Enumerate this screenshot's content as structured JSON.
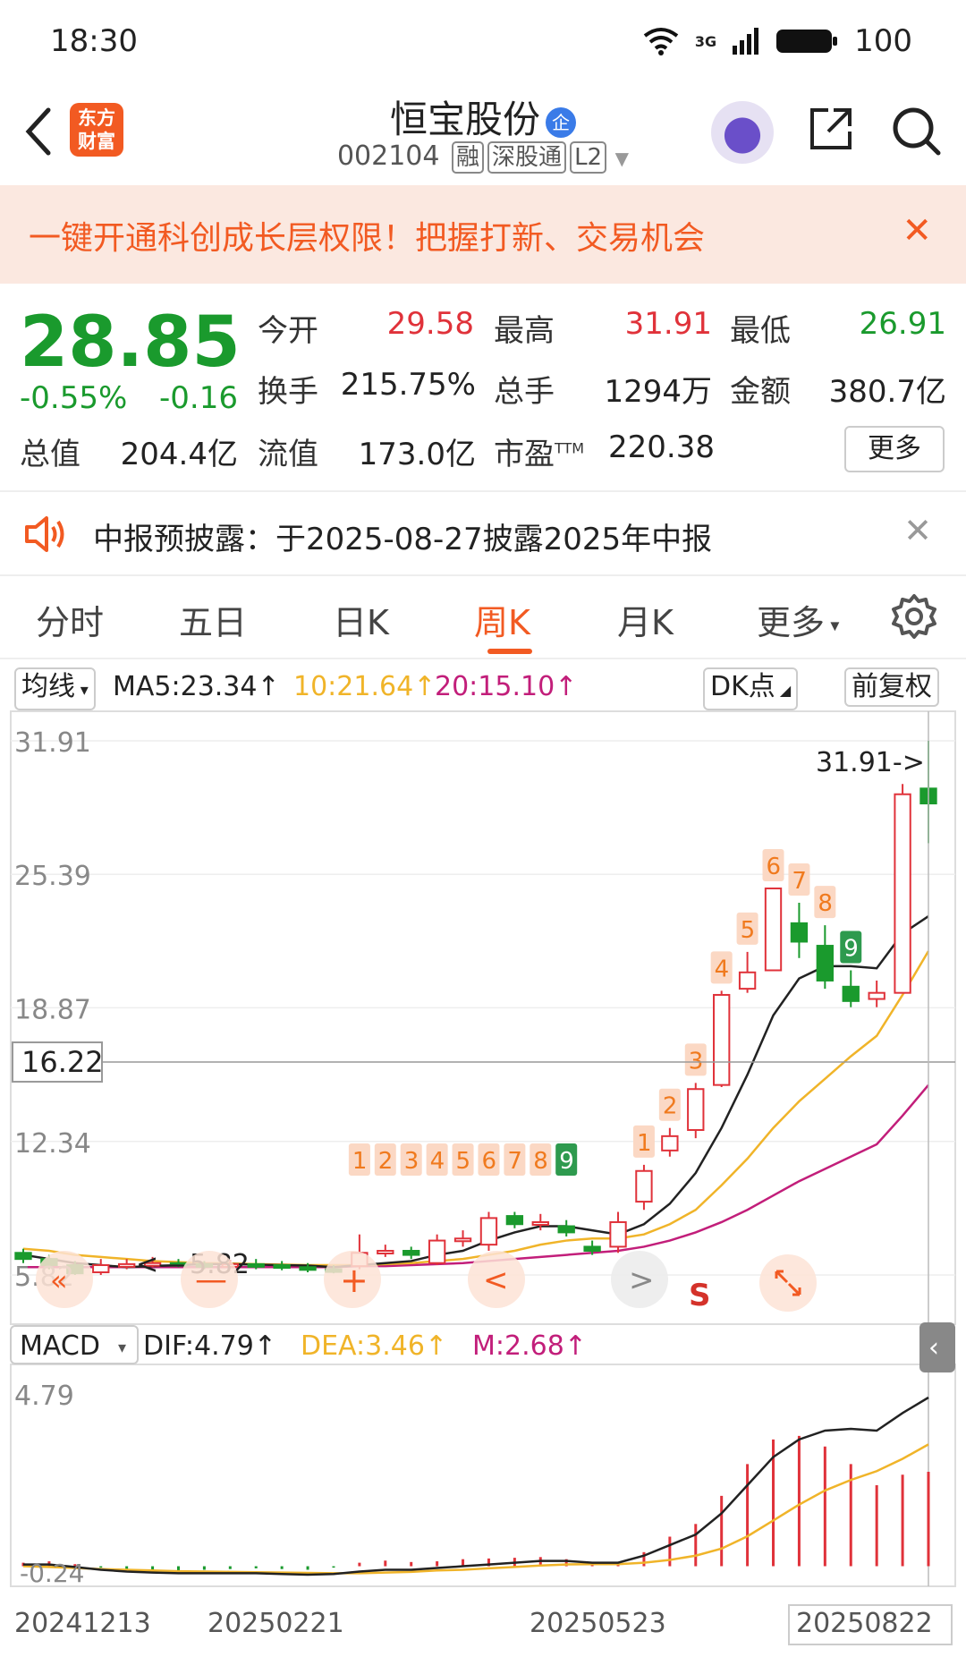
{
  "status": {
    "time": "18:30",
    "battery": "100",
    "network": "3G"
  },
  "header": {
    "title": "恒宝股份",
    "badge": "企",
    "code": "002104",
    "tags": [
      "融",
      "深股通",
      "L2"
    ]
  },
  "banner": {
    "text": "一键开通科创成长层权限！把握打新、交易机会"
  },
  "quote": {
    "price": "28.85",
    "change_pct": "-0.55%",
    "change": "-0.16",
    "fields": [
      {
        "label": "今开",
        "value": "29.58",
        "color": "#e0323a"
      },
      {
        "label": "最高",
        "value": "31.91",
        "color": "#e0323a"
      },
      {
        "label": "最低",
        "value": "26.91",
        "color": "#1a9a2d"
      },
      {
        "label": "换手",
        "value": "215.75%",
        "color": "#222"
      },
      {
        "label": "总手",
        "value": "1294万",
        "color": "#222"
      },
      {
        "label": "金额",
        "value": "380.7亿",
        "color": "#222"
      },
      {
        "label": "总值",
        "value": "204.4亿",
        "color": "#222"
      },
      {
        "label": "流值",
        "value": "173.0亿",
        "color": "#222"
      },
      {
        "label": "市盈",
        "sup": "TTM",
        "value": "220.38",
        "color": "#222"
      }
    ],
    "more": "更多"
  },
  "notice": {
    "text": "中报预披露：于2025-08-27披露2025年中报"
  },
  "tabs": [
    "分时",
    "五日",
    "日K",
    "周K",
    "月K",
    "更多"
  ],
  "active_tab": "周K",
  "chart_header": {
    "ma_toggle": "均线",
    "ma5": "MA5:23.34↑",
    "ma10": "10:21.64↑",
    "ma20": "20:15.10↑",
    "dk": "DK点",
    "adjust": "前复权"
  },
  "macd_header": {
    "toggle": "MACD",
    "dif": "DIF:4.79↑",
    "dea": "DEA:3.46↑",
    "m": "M:2.68↑"
  },
  "labels": {
    "high_marker": "31.91->",
    "low_marker": "5.82",
    "current_line": "16.22",
    "sell_signal": "S"
  },
  "colors": {
    "up": "#e0323a",
    "down": "#1a9a2d",
    "ma5": "#222222",
    "ma10": "#f0b429",
    "ma20": "#c21e7a",
    "accent": "#f25a22"
  },
  "chart_data": [
    {
      "type": "candlestick",
      "title": "周K",
      "ylim": [
        5.82,
        31.91
      ],
      "y_ticks": [
        "31.91",
        "25.39",
        "18.87",
        "12.34",
        "5.82"
      ],
      "x_ticks": [
        "20241213",
        "20250221",
        "20250523",
        "20250822"
      ],
      "candles": [
        [
          6.9,
          6.6,
          7.1,
          6.4
        ],
        [
          6.6,
          6.3,
          6.8,
          6.1
        ],
        [
          6.3,
          5.9,
          6.5,
          5.82
        ],
        [
          5.95,
          6.3,
          6.6,
          5.82
        ],
        [
          6.3,
          6.35,
          6.6,
          6.1
        ],
        [
          6.35,
          6.4,
          6.7,
          6.2
        ],
        [
          6.4,
          6.35,
          6.6,
          6.2
        ],
        [
          6.35,
          6.3,
          6.5,
          6.1
        ],
        [
          6.3,
          6.35,
          6.55,
          6.15
        ],
        [
          6.35,
          6.3,
          6.6,
          6.1
        ],
        [
          6.3,
          6.25,
          6.5,
          6.05
        ],
        [
          6.2,
          6.1,
          6.4,
          5.95
        ],
        [
          6.1,
          6.0,
          6.3,
          5.9
        ],
        [
          6.25,
          6.9,
          7.8,
          6.1
        ],
        [
          6.9,
          7.0,
          7.3,
          6.7
        ],
        [
          7.0,
          6.8,
          7.2,
          6.6
        ],
        [
          6.4,
          7.5,
          7.8,
          6.3
        ],
        [
          7.5,
          7.6,
          8.0,
          7.2
        ],
        [
          7.3,
          8.6,
          8.9,
          7.0
        ],
        [
          8.7,
          8.3,
          8.9,
          8.1
        ],
        [
          8.3,
          8.4,
          8.8,
          8.0
        ],
        [
          8.2,
          7.9,
          8.5,
          7.7
        ],
        [
          7.2,
          7.0,
          7.5,
          6.8
        ],
        [
          7.2,
          8.4,
          8.9,
          6.9
        ],
        [
          9.4,
          10.9,
          11.2,
          9.0
        ],
        [
          11.9,
          12.6,
          13.0,
          11.6
        ],
        [
          12.9,
          14.9,
          15.2,
          12.5
        ],
        [
          15.1,
          19.5,
          19.7,
          15.0
        ],
        [
          19.8,
          20.6,
          21.6,
          19.6
        ],
        [
          20.7,
          24.7,
          24.7,
          20.7
        ],
        [
          23.0,
          22.1,
          24.0,
          21.3
        ],
        [
          21.9,
          20.2,
          22.9,
          19.8
        ],
        [
          19.9,
          19.2,
          20.7,
          18.9
        ],
        [
          19.3,
          19.6,
          20.2,
          18.9
        ],
        [
          19.6,
          29.3,
          29.8,
          19.6
        ],
        [
          29.58,
          28.85,
          31.91,
          26.91
        ]
      ],
      "ma5": [
        6.8,
        6.6,
        6.4,
        6.3,
        6.2,
        6.25,
        6.3,
        6.35,
        6.35,
        6.32,
        6.3,
        6.28,
        6.2,
        6.3,
        6.4,
        6.5,
        6.8,
        7.0,
        7.5,
        7.9,
        8.2,
        8.2,
        8.0,
        7.8,
        8.3,
        9.3,
        10.8,
        13.0,
        15.6,
        18.5,
        20.3,
        20.9,
        20.9,
        20.8,
        22.5,
        23.34
      ],
      "ma10": [
        7.1,
        7.0,
        6.8,
        6.7,
        6.6,
        6.5,
        6.45,
        6.4,
        6.38,
        6.35,
        6.33,
        6.3,
        6.3,
        6.3,
        6.35,
        6.4,
        6.5,
        6.6,
        6.8,
        7.0,
        7.3,
        7.5,
        7.6,
        7.6,
        7.8,
        8.3,
        9.0,
        10.2,
        11.5,
        13.0,
        14.3,
        15.4,
        16.5,
        17.5,
        19.5,
        21.64
      ],
      "ma20": [
        6.2,
        6.2,
        6.2,
        6.2,
        6.2,
        6.2,
        6.2,
        6.2,
        6.2,
        6.2,
        6.2,
        6.2,
        6.2,
        6.25,
        6.25,
        6.3,
        6.35,
        6.4,
        6.5,
        6.6,
        6.7,
        6.8,
        6.9,
        7.0,
        7.2,
        7.5,
        7.9,
        8.4,
        9.0,
        9.7,
        10.4,
        11.0,
        11.6,
        12.2,
        13.6,
        15.1
      ]
    },
    {
      "type": "macd",
      "ylim": [
        -0.24,
        4.79
      ],
      "y_ticks": [
        "4.79",
        "-0.24"
      ],
      "dif": [
        0.05,
        0.05,
        -0.02,
        -0.1,
        -0.15,
        -0.18,
        -0.2,
        -0.2,
        -0.2,
        -0.2,
        -0.22,
        -0.24,
        -0.22,
        -0.15,
        -0.1,
        -0.1,
        -0.05,
        0.0,
        0.05,
        0.1,
        0.15,
        0.15,
        0.1,
        0.1,
        0.3,
        0.6,
        0.9,
        1.5,
        2.3,
        3.1,
        3.6,
        3.85,
        3.9,
        3.85,
        4.35,
        4.79
      ],
      "dea": [
        0.0,
        -0.02,
        -0.05,
        -0.08,
        -0.1,
        -0.12,
        -0.14,
        -0.15,
        -0.16,
        -0.17,
        -0.18,
        -0.19,
        -0.2,
        -0.2,
        -0.18,
        -0.16,
        -0.12,
        -0.1,
        -0.06,
        -0.02,
        0.02,
        0.05,
        0.06,
        0.06,
        0.1,
        0.18,
        0.3,
        0.5,
        0.85,
        1.3,
        1.75,
        2.15,
        2.45,
        2.7,
        3.05,
        3.46
      ],
      "m": [
        0.1,
        0.14,
        0.06,
        -0.04,
        -0.1,
        -0.12,
        -0.12,
        -0.1,
        -0.08,
        -0.06,
        -0.08,
        -0.1,
        -0.04,
        0.1,
        0.16,
        0.12,
        0.14,
        0.2,
        0.22,
        0.24,
        0.26,
        0.2,
        0.08,
        0.08,
        0.4,
        0.84,
        1.2,
        2.0,
        2.9,
        3.6,
        3.7,
        3.4,
        2.9,
        2.3,
        2.6,
        2.68
      ]
    }
  ]
}
